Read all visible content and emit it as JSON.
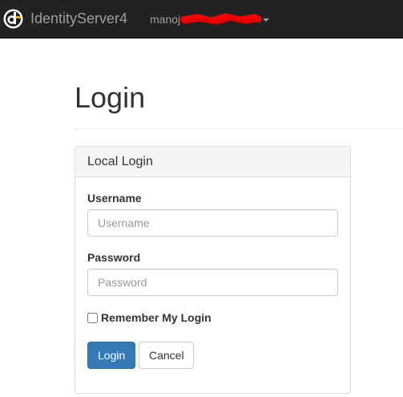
{
  "navbar": {
    "brand": "IdentityServer4",
    "user_name": "manoj"
  },
  "page": {
    "title": "Login"
  },
  "login_panel": {
    "title": "Local Login",
    "username_label": "Username",
    "username_placeholder": "Username",
    "username_value": "",
    "password_label": "Password",
    "password_placeholder": "Password",
    "password_value": "",
    "remember_label": "Remember My Login",
    "remember_checked": false,
    "login_button": "Login",
    "cancel_button": "Cancel"
  },
  "colors": {
    "navbar_bg": "#222222",
    "primary": "#337ab7",
    "logo_accent": "#f0a30a"
  }
}
